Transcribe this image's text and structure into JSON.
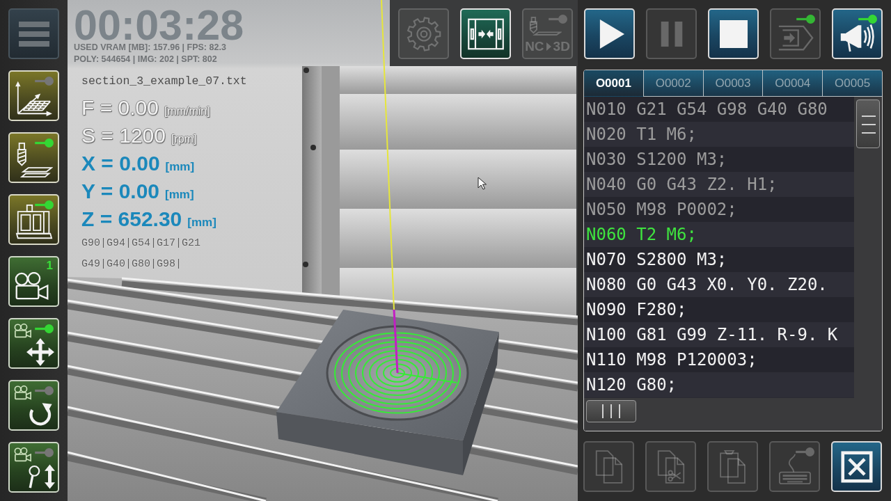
{
  "sidebar": {
    "buttons": [
      {
        "kind": "menu"
      },
      {
        "kind": "grid",
        "toggle_on": false
      },
      {
        "kind": "toolpath",
        "toggle_on": true
      },
      {
        "kind": "machine",
        "toggle_on": true
      },
      {
        "kind": "camera",
        "badge": "1"
      },
      {
        "kind": "pan",
        "toggle_on": true
      },
      {
        "kind": "rotate",
        "toggle_on": false
      },
      {
        "kind": "zoom",
        "toggle_on": false
      }
    ]
  },
  "viewport": {
    "timer": "00:03:28",
    "stats": [
      "USED VRAM [MB]: 157.96 | FPS: 82.3",
      "POLY: 544654 | IMG: 202 | SPT: 802"
    ],
    "file_name": "section_3_example_07.txt",
    "readouts": [
      {
        "kind": "rate",
        "text": "F = 0.00",
        "unit": "[mm/min]"
      },
      {
        "kind": "rate",
        "text": "S = 1200",
        "unit": "[rpm]"
      },
      {
        "kind": "axis",
        "text": "X = 0.00",
        "unit": "[mm]"
      },
      {
        "kind": "axis",
        "text": "Y = 0.00",
        "unit": "[mm]"
      },
      {
        "kind": "axis",
        "text": "Z = 652.30",
        "unit": "[mm]"
      }
    ],
    "modal_codes": [
      "G90|G94|G54|G17|G21",
      "G49|G40|G80|G98|"
    ]
  },
  "toolbar": {
    "buttons": [
      {
        "kind": "settings",
        "disabled": true
      },
      {
        "kind": "fit",
        "disabled": false
      },
      {
        "kind": "nc-3d",
        "disabled": true,
        "toggle_on": false,
        "label_left": "NC",
        "label_right": "3D"
      },
      {
        "kind": "play",
        "disabled": false
      },
      {
        "kind": "pause",
        "disabled": true
      },
      {
        "kind": "stop",
        "disabled": false
      },
      {
        "kind": "export",
        "disabled": true,
        "toggle_on": true
      },
      {
        "kind": "sound",
        "disabled": false,
        "toggle_on": true
      }
    ]
  },
  "program_panel": {
    "tabs": [
      {
        "label": "O0001",
        "selected": true
      },
      {
        "label": "O0002",
        "selected": false
      },
      {
        "label": "O0003",
        "selected": false
      },
      {
        "label": "O0004",
        "selected": false
      },
      {
        "label": "O0005",
        "selected": false
      }
    ],
    "lines": [
      {
        "text": "N010 G21 G54 G98 G40 G80",
        "executed": true,
        "current": false
      },
      {
        "text": "N020 T1 M6;",
        "executed": true,
        "current": false
      },
      {
        "text": "N030 S1200 M3;",
        "executed": true,
        "current": false
      },
      {
        "text": "N040 G0 G43 Z2. H1;",
        "executed": true,
        "current": false
      },
      {
        "text": "N050 M98 P0002;",
        "executed": true,
        "current": false
      },
      {
        "text": "N060 T2 M6;",
        "executed": false,
        "current": true
      },
      {
        "text": "N070 S2800 M3;",
        "executed": false,
        "current": false
      },
      {
        "text": "N080 G0 G43 X0. Y0. Z20.",
        "executed": false,
        "current": false
      },
      {
        "text": "N090 F280;",
        "executed": false,
        "current": false
      },
      {
        "text": "N100 G81 G99 Z-11. R-9. K",
        "executed": false,
        "current": false
      },
      {
        "text": "N110 M98 P120003;",
        "executed": false,
        "current": false
      },
      {
        "text": "N120 G80;",
        "executed": false,
        "current": false
      }
    ]
  },
  "bottom_toolbar": {
    "buttons": [
      {
        "kind": "copy",
        "disabled": true
      },
      {
        "kind": "cut",
        "disabled": true
      },
      {
        "kind": "paste",
        "disabled": true
      },
      {
        "kind": "keyboard",
        "disabled": true,
        "toggle_on": false
      },
      {
        "kind": "close",
        "disabled": false
      }
    ]
  }
}
